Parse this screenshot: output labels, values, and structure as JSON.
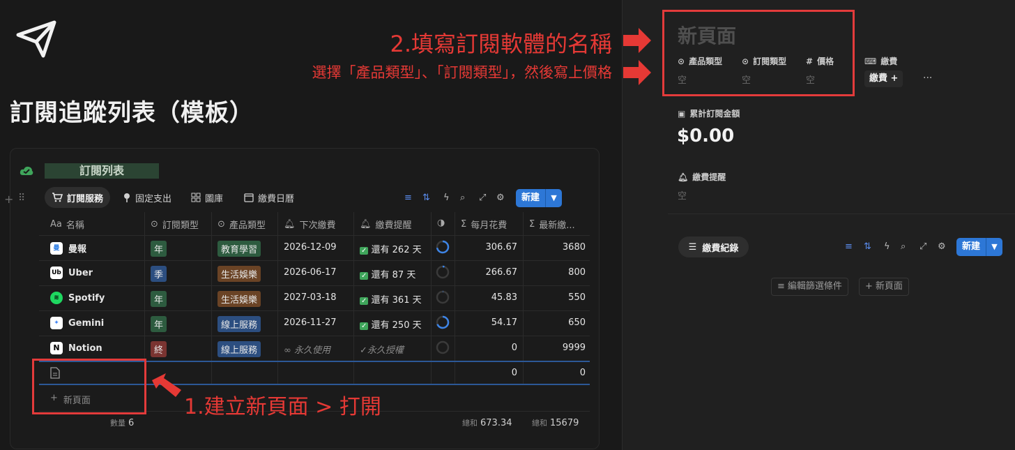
{
  "page": {
    "title": "訂閱追蹤列表（模板）"
  },
  "database": {
    "title": "訂閱列表",
    "tabs": [
      {
        "label": "訂閱服務",
        "icon": "cart-icon",
        "active": true
      },
      {
        "label": "固定支出",
        "icon": "pin-icon",
        "active": false
      },
      {
        "label": "圖庫",
        "icon": "gallery-icon",
        "active": false
      },
      {
        "label": "繳費日曆",
        "icon": "calendar-icon",
        "active": false
      }
    ],
    "new_button": "新建",
    "columns": [
      "名稱",
      "訂閱類型",
      "產品類型",
      "下次繳費",
      "繳費提醒",
      "每月花費",
      "最新繳..."
    ],
    "rows": [
      {
        "name": "曼報",
        "sub": "年",
        "prod": "教育學習",
        "next": "2026-12-09",
        "remind": "還有 262 天",
        "progress": 0.72,
        "monthly": "306.67",
        "latest": "3680"
      },
      {
        "name": "Uber",
        "sub": "季",
        "prod": "生活娛樂",
        "next": "2026-06-17",
        "remind": "還有 87 天",
        "progress": 0.05,
        "monthly": "266.67",
        "latest": "800"
      },
      {
        "name": "Spotify",
        "sub": "年",
        "prod": "生活娛樂",
        "next": "2027-03-18",
        "remind": "還有 361 天",
        "progress": 0.01,
        "monthly": "45.83",
        "latest": "550"
      },
      {
        "name": "Gemini",
        "sub": "年",
        "prod": "線上服務",
        "next": "2026-11-27",
        "remind": "還有 250 天",
        "progress": 0.69,
        "monthly": "54.17",
        "latest": "650"
      },
      {
        "name": "Notion",
        "sub": "終",
        "prod": "線上服務",
        "next": "∞ 永久使用",
        "remind": "✓永久授權",
        "progress": 0,
        "monthly": "0",
        "latest": "9999"
      }
    ],
    "blank_row": {
      "monthly": "0",
      "latest": "0"
    },
    "add_page": "新頁面",
    "summary": {
      "count_label": "數量",
      "count": "6",
      "sum_label_1": "總和",
      "sum_1": "673.34",
      "sum_label_2": "總和",
      "sum_2": "15679"
    }
  },
  "annotations": {
    "step1": "1.建立新頁面 > 打開",
    "step2_title": "2.填寫訂閱軟體的名稱",
    "step2_sub": "選擇「產品類型」、「訂閱類型」，然後寫上價格"
  },
  "side_panel": {
    "title": "新頁面",
    "props": [
      {
        "label": "產品類型",
        "value": "空"
      },
      {
        "label": "訂閱類型",
        "value": "空"
      },
      {
        "label": "價格",
        "value": "空"
      }
    ],
    "pay": {
      "label": "繳費",
      "button": "繳費 +"
    },
    "more": "···",
    "total": {
      "label": "累計訂閱金額",
      "value": "$0.00"
    },
    "reminder": {
      "label": "繳費提醒",
      "value": "空"
    },
    "records": {
      "label": "繳費紀錄",
      "new_button": "新建",
      "edit_filter": "編輯篩選條件",
      "add_page": "新頁面"
    }
  },
  "colors": {
    "accent": "#2d77d6",
    "annotation": "#e53935",
    "tag_green": "#2d5b3f",
    "tag_blue": "#2c4e80",
    "tag_red": "#7a3431",
    "tag_brown": "#6a4325"
  }
}
